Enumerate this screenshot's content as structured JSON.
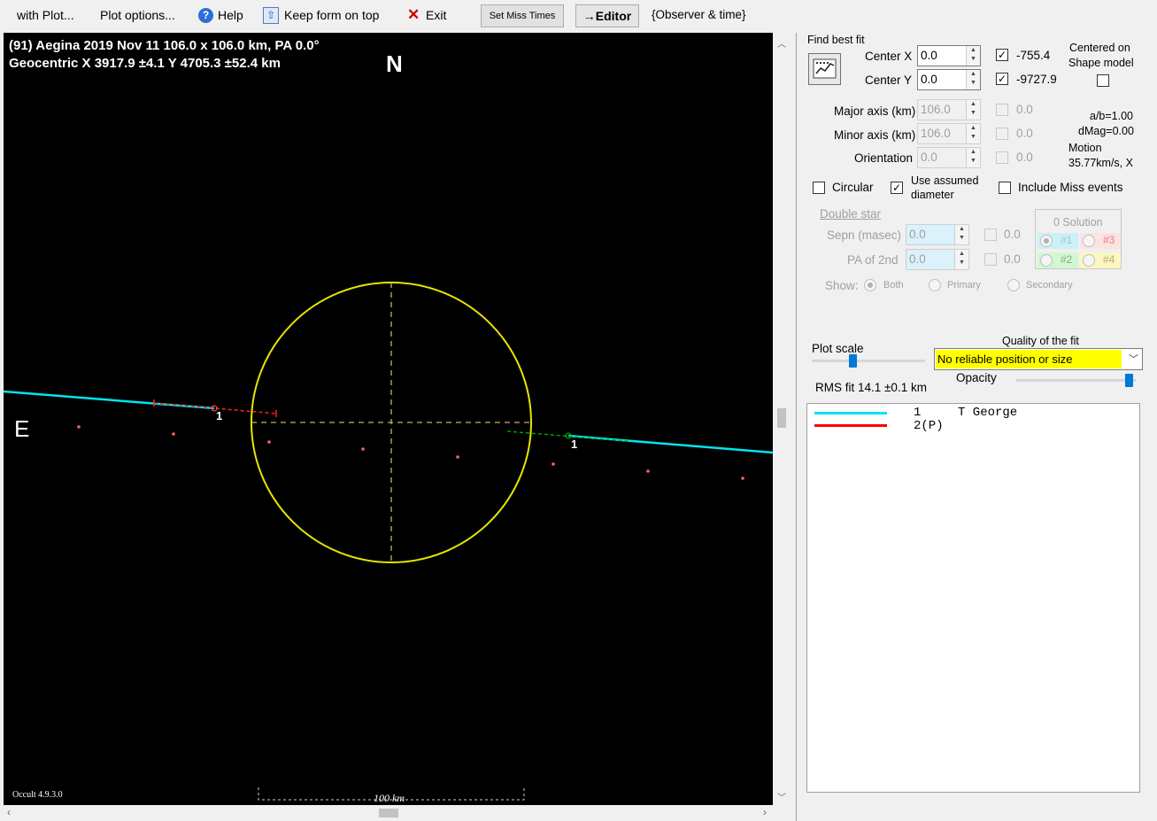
{
  "menu": {
    "plot_menu": "with Plot...",
    "plot_options": "Plot options...",
    "help": "Help",
    "keep_on_top": "Keep form on top",
    "exit": "Exit",
    "set_miss_times": "Set Miss Times",
    "editor": "→Editor",
    "observer_time": "{Observer & time}"
  },
  "plot": {
    "title_line1": "(91) Aegina  2019 Nov 11   106.0 x 106.0 km, PA 0.0°",
    "title_line2": "Geocentric  X  3917.9 ±4.1  Y 4705.3 ±52.4 km",
    "north_label": "N",
    "east_label": "E",
    "version": "Occult 4.9.3.0",
    "scale_label": "100 km",
    "chord_label_left": "1",
    "chord_label_right": "1",
    "colors": {
      "background": "#000000",
      "ellipse": "#e6e600",
      "chord1": "#00e5ee",
      "chord2": "#ff2020",
      "miss_dots": "#ff6060"
    }
  },
  "panel": {
    "find_best_fit": "Find best fit",
    "center_x": {
      "label": "Center X",
      "value": "0.0",
      "checked": true,
      "result": "-755.4"
    },
    "center_y": {
      "label": "Center Y",
      "value": "0.0",
      "checked": true,
      "result": "-9727.9"
    },
    "centered_on": "Centered on",
    "shape_model": "Shape model",
    "major_axis": {
      "label": "Major axis (km)",
      "value": "106.0",
      "result": "0.0"
    },
    "minor_axis": {
      "label": "Minor axis (km)",
      "value": "106.0",
      "result": "0.0"
    },
    "orientation": {
      "label": "Orientation",
      "value": "0.0",
      "result": "0.0"
    },
    "ab_ratio": "a/b=1.00",
    "dmag": "dMag=0.00",
    "motion_label": "Motion",
    "motion_value": "35.77km/s, X",
    "circular": "Circular",
    "use_assumed_1": "Use assumed",
    "use_assumed_2": "diameter",
    "include_miss": "Include Miss events",
    "double_star": "Double star",
    "sepn": {
      "label": "Sepn (masec)",
      "value": "0.0",
      "result": "0.0"
    },
    "pa2": {
      "label": "PA of 2nd",
      "value": "0.0",
      "result": "0.0"
    },
    "show": "Show:",
    "both": "Both",
    "primary": "Primary",
    "secondary": "Secondary",
    "solution_title": "0 Solution",
    "sol1": "#1",
    "sol2": "#2",
    "sol3": "#3",
    "sol4": "#4",
    "plot_scale": "Plot scale",
    "quality_label": "Quality of the fit",
    "quality_value": "No reliable position or size",
    "opacity": "Opacity",
    "rms_fit": "RMS fit 14.1 ±0.1 km"
  },
  "legend": [
    {
      "color": "#00e5ee",
      "id": "1",
      "observer": "T George"
    },
    {
      "color": "#ff0000",
      "id": "2(P)",
      "observer": ""
    }
  ]
}
